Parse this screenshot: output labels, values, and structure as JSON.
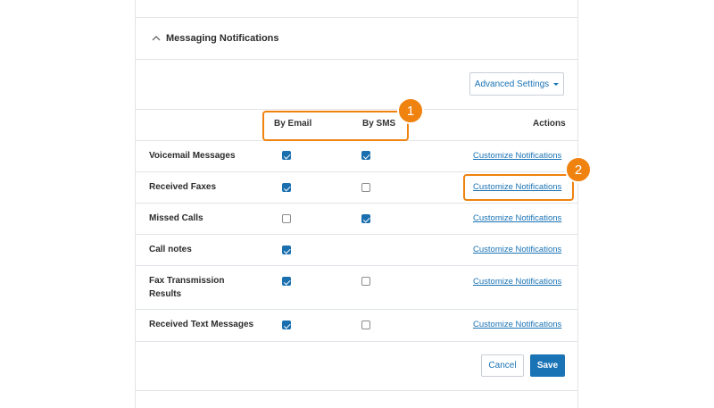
{
  "section": {
    "title": "Messaging Notifications",
    "collapse_icon": "chevron-up-icon"
  },
  "advanced_settings": {
    "label": "Advanced Settings",
    "icon": "caret-down-icon"
  },
  "columns": {
    "by_email": "By Email",
    "by_sms": "By SMS",
    "actions": "Actions"
  },
  "rows": [
    {
      "label": "Voicemail Messages",
      "email": true,
      "sms": true,
      "action": "Customize Notifications"
    },
    {
      "label": "Received Faxes",
      "email": true,
      "sms": false,
      "action": "Customize Notifications"
    },
    {
      "label": "Missed Calls",
      "email": false,
      "sms": true,
      "action": "Customize Notifications"
    },
    {
      "label": "Call notes",
      "email": true,
      "sms": null,
      "action": "Customize Notifications"
    },
    {
      "label": "Fax Transmission Results",
      "email": true,
      "sms": false,
      "action": "Customize Notifications"
    },
    {
      "label": "Received Text Messages",
      "email": true,
      "sms": false,
      "action": "Customize Notifications"
    }
  ],
  "footer": {
    "cancel_label": "Cancel",
    "save_label": "Save"
  },
  "callouts": {
    "one": "1",
    "two": "2",
    "color": "#f0820f"
  },
  "colors": {
    "accent": "#1a73b5",
    "checkbox_checked": "#1a6fae",
    "border": "#e1e4e8"
  }
}
